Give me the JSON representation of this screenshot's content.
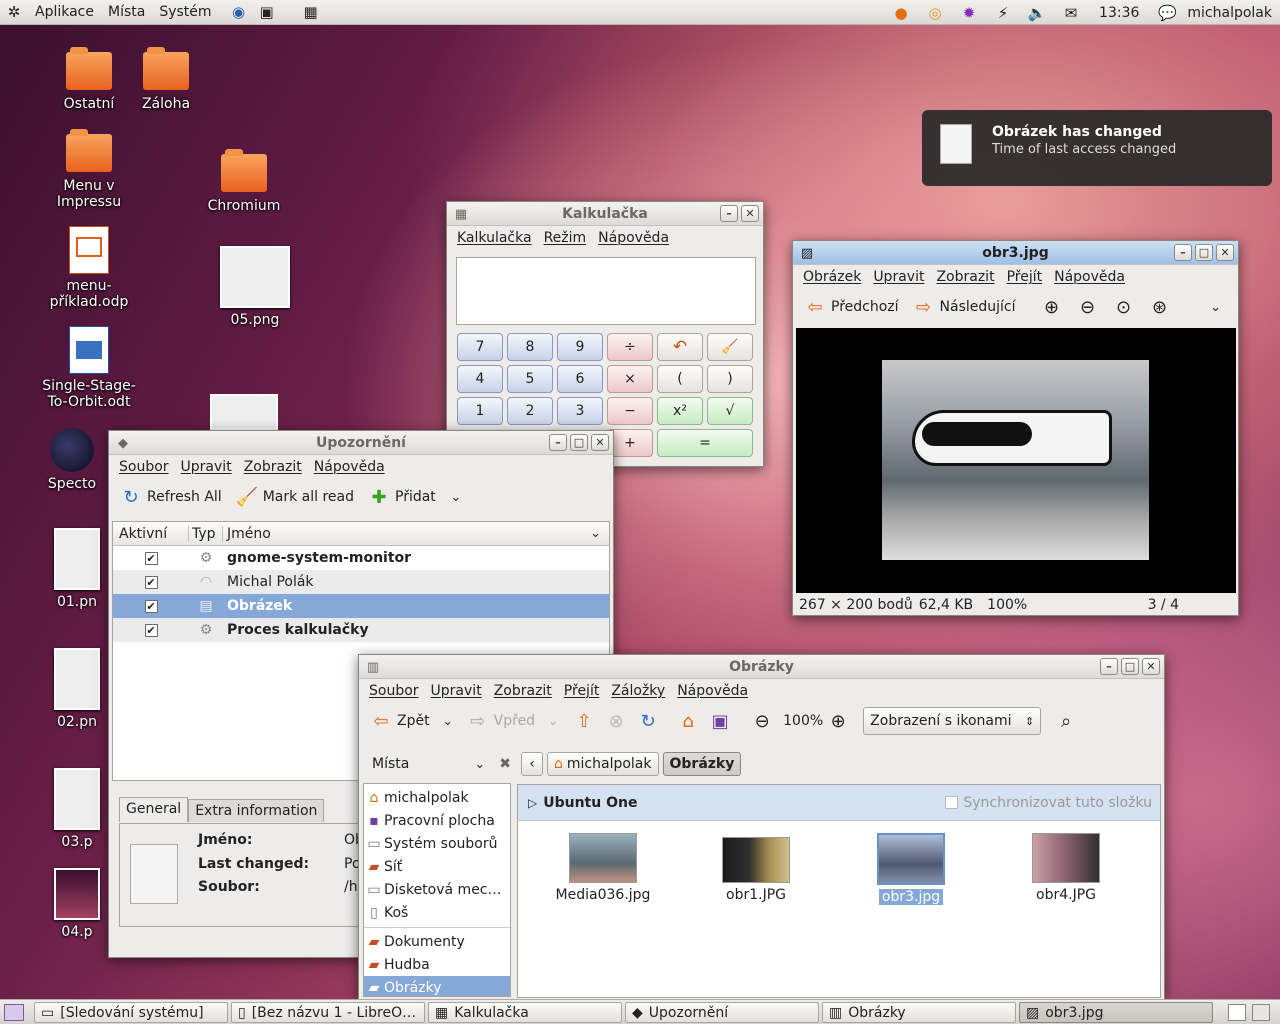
{
  "top_panel": {
    "menus": [
      "Aplikace",
      "Místa",
      "Systém"
    ],
    "clock": "13:36",
    "user": "michalpolak"
  },
  "desktop_icons": [
    {
      "label": "Ostatní",
      "kind": "folder"
    },
    {
      "label": "Záloha",
      "kind": "folder"
    },
    {
      "label": "Menu v Impressu",
      "kind": "folder"
    },
    {
      "label": "Chromium",
      "kind": "folder"
    },
    {
      "label": "menu-příklad.odp",
      "kind": "doc"
    },
    {
      "label": "05.png",
      "kind": "thumb"
    },
    {
      "label": "Single-Stage-To-Orbit.odt",
      "kind": "doc"
    },
    {
      "label": "Specto",
      "kind": "app"
    },
    {
      "label": "01.pn",
      "kind": "thumb"
    },
    {
      "label": "02.pn",
      "kind": "thumb"
    },
    {
      "label": "03.p",
      "kind": "thumb"
    },
    {
      "label": "04.p",
      "kind": "thumb"
    }
  ],
  "notification": {
    "title": "Obrázek has changed",
    "body": "Time of last access changed"
  },
  "calculator": {
    "title": "Kalkulačka",
    "menus": [
      "Kalkulačka",
      "Režim",
      "Nápověda"
    ],
    "buttons": [
      "7",
      "8",
      "9",
      "÷",
      "↶",
      "🧹",
      "4",
      "5",
      "6",
      "×",
      "(",
      ")",
      "1",
      "2",
      "3",
      "−",
      "x²",
      "√",
      "+",
      "="
    ]
  },
  "viewer": {
    "title": "obr3.jpg",
    "menus": [
      "Obrázek",
      "Upravit",
      "Zobrazit",
      "Přejít",
      "Nápověda"
    ],
    "prev": "Předchozí",
    "next": "Následující",
    "status_size": "267 × 200 bodů",
    "status_bytes": "62,4 KB",
    "status_zoom": "100%",
    "status_index": "3 / 4"
  },
  "specto": {
    "title": "Upozornění",
    "menus": [
      "Soubor",
      "Upravit",
      "Zobrazit",
      "Nápověda"
    ],
    "toolbar": {
      "refresh": "Refresh All",
      "mark": "Mark all read",
      "add": "Přidat"
    },
    "columns": {
      "active": "Aktivní",
      "type": "Typ",
      "name": "Jméno"
    },
    "rows": [
      {
        "name": "gnome-system-monitor",
        "bold": true,
        "checked": "✔"
      },
      {
        "name": "Michal Polák",
        "bold": false,
        "checked": "✔"
      },
      {
        "name": "Obrázek",
        "bold": true,
        "checked": "✔"
      },
      {
        "name": "Proces kalkulačky",
        "bold": true,
        "checked": "✔"
      }
    ],
    "tabs": {
      "general": "General",
      "extra": "Extra information"
    },
    "details": {
      "name_label": "Jméno:",
      "name_value": "Ob",
      "changed_label": "Last changed:",
      "changed_value": "Po",
      "file_label": "Soubor:",
      "file_value": "/h"
    }
  },
  "files": {
    "title": "Obrázky",
    "menus": [
      "Soubor",
      "Upravit",
      "Zobrazit",
      "Přejít",
      "Záložky",
      "Nápověda"
    ],
    "back": "Zpět",
    "forward": "Vpřed",
    "zoom": "100%",
    "view_mode": "Zobrazení s ikonami",
    "side_title": "Místa",
    "places": [
      "michalpolak",
      "Pracovní plocha",
      "Systém souborů",
      "Síť",
      "Disketová mec…",
      "Koš"
    ],
    "bookmarks": [
      "Dokumenty",
      "Hudba",
      "Obrázky"
    ],
    "path": [
      "michalpolak",
      "Obrázky"
    ],
    "ubuntu_one": "Ubuntu One",
    "sync": "Synchronizovat tuto složku",
    "items": [
      "Media036.jpg",
      "obr1.JPG",
      "obr3.jpg",
      "obr4.JPG"
    ]
  },
  "taskbar": [
    "[Sledování systému]",
    "[Bez názvu 1 - LibreO…",
    "Kalkulačka",
    "Upozornění",
    "Obrázky",
    "obr3.jpg"
  ]
}
